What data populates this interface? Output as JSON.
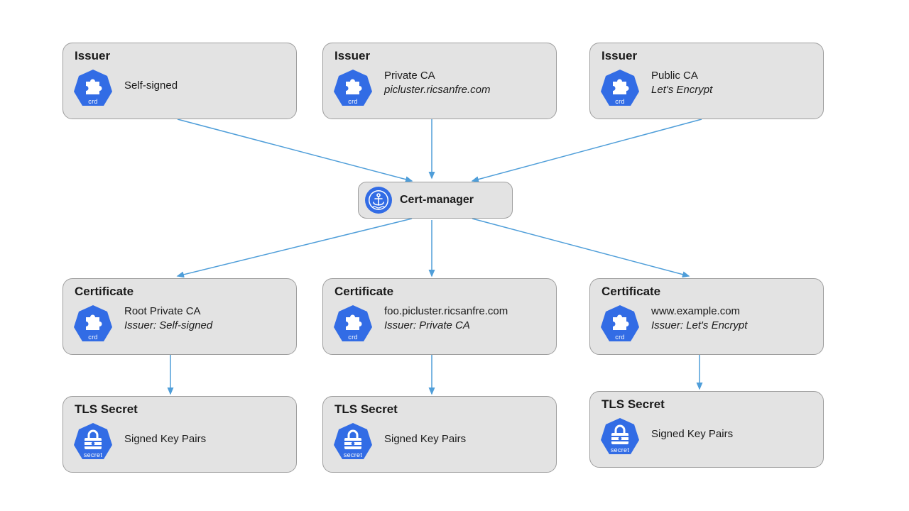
{
  "colors": {
    "box_fill": "#e3e3e3",
    "box_border": "#9e9e9e",
    "arrow": "#4f9ed9",
    "k8s_blue": "#326ce5"
  },
  "center": {
    "label": "Cert-manager"
  },
  "issuers": [
    {
      "title": "Issuer",
      "line1": "Self-signed",
      "line2": "",
      "icon": "crd"
    },
    {
      "title": "Issuer",
      "line1": "Private CA",
      "line2": "picluster.ricsanfre.com",
      "icon": "crd"
    },
    {
      "title": "Issuer",
      "line1": "Public CA",
      "line2": "Let's Encrypt",
      "icon": "crd"
    }
  ],
  "certs": [
    {
      "title": "Certificate",
      "line1": "Root Private CA",
      "line2": "Issuer: Self-signed",
      "icon": "crd"
    },
    {
      "title": "Certificate",
      "line1": "foo.picluster.ricsanfre.com",
      "line2": "Issuer: Private CA",
      "icon": "crd"
    },
    {
      "title": "Certificate",
      "line1": "www.example.com",
      "line2": "Issuer: Let's Encrypt",
      "icon": "crd"
    }
  ],
  "secrets": [
    {
      "title": "TLS Secret",
      "line1": "Signed Key Pairs",
      "icon": "secret"
    },
    {
      "title": "TLS Secret",
      "line1": "Signed Key Pairs",
      "icon": "secret"
    },
    {
      "title": "TLS Secret",
      "line1": "Signed Key Pairs",
      "icon": "secret"
    }
  ],
  "icon_labels": {
    "crd": "crd",
    "secret": "secret"
  }
}
